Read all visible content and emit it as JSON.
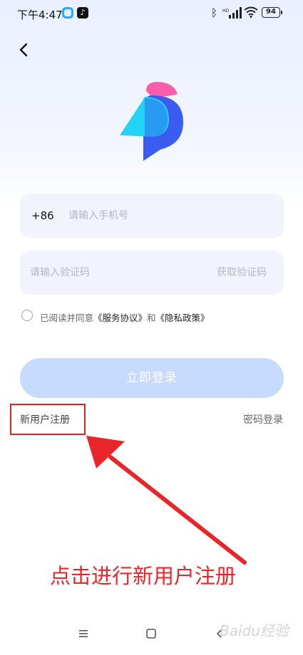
{
  "status_bar": {
    "time": "下午4:47",
    "battery": "94",
    "icons": [
      "app-icon",
      "tiktok-icon",
      "bluetooth-icon",
      "hd-signal-icon",
      "wifi-icon",
      "battery-icon"
    ]
  },
  "header": {
    "back_icon": "chevron-left-icon"
  },
  "logo": {
    "icon": "bird-logo-icon",
    "colors": [
      "#ff5cab",
      "#21d4f5",
      "#3a5cf0"
    ]
  },
  "phone_field": {
    "prefix": "+86",
    "placeholder": "请输入手机号",
    "value": ""
  },
  "code_field": {
    "placeholder": "请输入验证码",
    "value": "",
    "action": "获取验证码"
  },
  "agreement": {
    "checked": false,
    "prefix": "已阅读并同意",
    "service": "《服务协议》",
    "and": "和",
    "privacy": "《隐私政策》"
  },
  "login_button": {
    "label": "立即登录",
    "color": "#c6dbfd"
  },
  "register": {
    "label": "新用户注册",
    "highlight_color": "#e22222"
  },
  "password_login": {
    "label": "密码登录"
  },
  "annotation": {
    "text": "点击进行新用户注册",
    "color": "#e8262a"
  },
  "nav_bar": {
    "icons": [
      "menu-icon",
      "home-icon",
      "back-icon"
    ]
  },
  "watermark": {
    "text": "Baidu经验"
  }
}
